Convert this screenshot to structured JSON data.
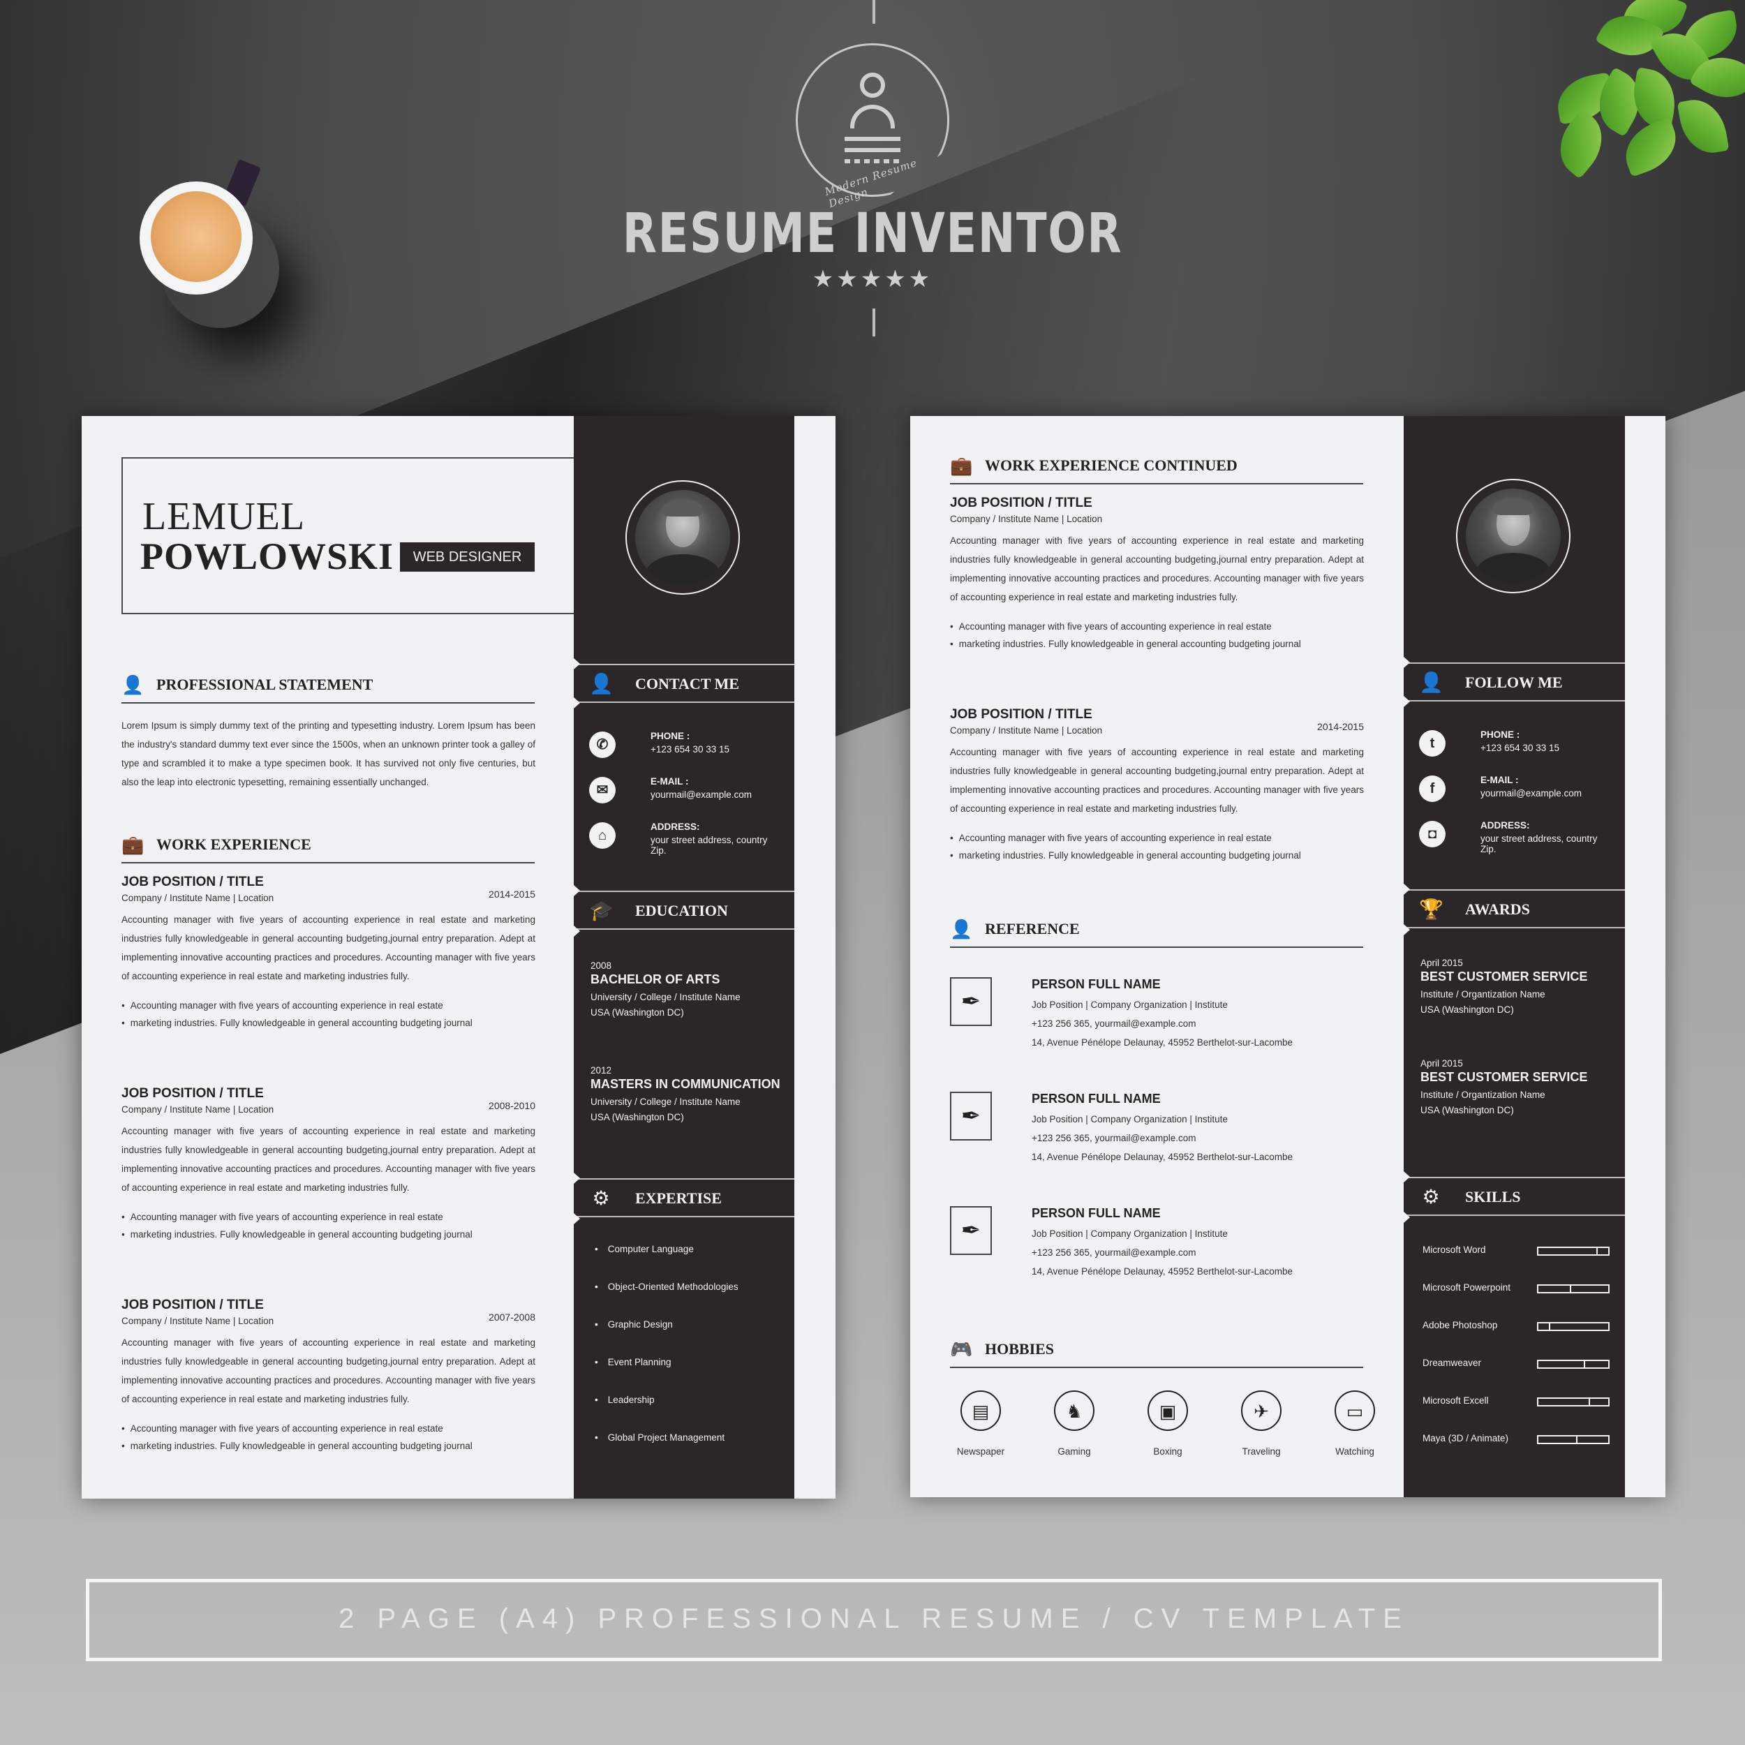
{
  "branding": {
    "logo_tagline": "Modern Resume Design",
    "title": "RESUME INVENTOR",
    "rating_stars": 5,
    "stars": "★★★★★"
  },
  "footer": {
    "banner": "2 PAGE (A4) PROFESSIONAL RESUME / CV TEMPLATE"
  },
  "page1": {
    "first_name": "LEMUEL",
    "last_name": "POWLOWSKI",
    "role": "WEB DESIGNER",
    "statement": {
      "title": "PROFESSIONAL STATEMENT",
      "icon": "user-tie-icon",
      "text": "Lorem Ipsum is simply dummy text of the printing and typesetting industry. Lorem Ipsum has been the industry's standard dummy text ever since the 1500s, when an unknown printer took a galley of type and scrambled it to make a type specimen book. It has survived not only five centuries, but also the leap into electronic typesetting, remaining essentially unchanged."
    },
    "work": {
      "title": "WORK EXPERIENCE",
      "icon": "briefcase-icon",
      "jobs": [
        {
          "title": "JOB POSITION / TITLE",
          "company": "Company / Institute Name  |  Location",
          "dates": "2014-2015",
          "desc": "Accounting manager with five years of accounting experience in real estate and marketing industries fully knowledgeable in general accounting budgeting,journal entry preparation. Adept at implementing innovative accounting practices and procedures. Accounting manager with five years of accounting experience in real estate and marketing industries fully.",
          "bullets": [
            "Accounting manager with five years of accounting experience in real estate",
            "marketing industries. Fully knowledgeable in general accounting budgeting journal"
          ]
        },
        {
          "title": "JOB POSITION / TITLE",
          "company": "Company / Institute Name  |  Location",
          "dates": "2008-2010",
          "desc": "Accounting manager with five years of accounting experience in real estate and marketing industries fully knowledgeable in general accounting budgeting,journal entry preparation. Adept at implementing innovative accounting practices and procedures. Accounting manager with five years of accounting experience in real estate and marketing industries fully.",
          "bullets": [
            "Accounting manager with five years of accounting experience in real estate",
            "marketing industries. Fully knowledgeable in general accounting budgeting journal"
          ]
        },
        {
          "title": "JOB POSITION / TITLE",
          "company": "Company / Institute Name  |  Location",
          "dates": "2007-2008",
          "desc": "Accounting manager with five years of accounting experience in real estate and marketing industries fully knowledgeable in general accounting budgeting,journal entry preparation. Adept at implementing innovative accounting practices and procedures. Accounting manager with five years of accounting experience in real estate and marketing industries fully.",
          "bullets": [
            "Accounting manager with five years of accounting experience in real estate",
            "marketing industries. Fully knowledgeable in general accounting budgeting journal"
          ]
        }
      ]
    },
    "contact": {
      "title": "CONTACT ME",
      "items": [
        {
          "icon": "phone-icon",
          "glyph": "✆",
          "label": "PHONE :",
          "value": "+123 654 30 33 15"
        },
        {
          "icon": "envelope-icon",
          "glyph": "✉",
          "label": "E-MAIL :",
          "value": "yourmail@example.com"
        },
        {
          "icon": "home-icon",
          "glyph": "⌂",
          "label": "ADDRESS:",
          "value": "your street address, country Zip."
        }
      ]
    },
    "education": {
      "title": "EDUCATION",
      "items": [
        {
          "year": "2008",
          "degree": "BACHELOR OF ARTS",
          "school": "University / College / Institute Name",
          "place": "USA (Washington DC)"
        },
        {
          "year": "2012",
          "degree": "MASTERS IN COMMUNICATION",
          "school": "University / College / Institute Name",
          "place": "USA (Washington DC)"
        }
      ]
    },
    "expertise": {
      "title": "EXPERTISE",
      "items": [
        "Computer Language",
        "Object-Oriented Methodologies",
        "Graphic Design",
        "Event Planning",
        "Leadership",
        "Global Project Management"
      ]
    }
  },
  "page2": {
    "work": {
      "title": "WORK EXPERIENCE CONTINUED",
      "jobs": [
        {
          "title": "JOB POSITION / TITLE",
          "company": "Company / Institute Name  |  Location",
          "dates": "",
          "desc": "Accounting manager with five years of accounting experience in real estate and marketing industries fully knowledgeable in general accounting budgeting,journal entry preparation. Adept at implementing innovative accounting practices and procedures. Accounting manager with five years of accounting experience in real estate and marketing industries fully.",
          "bullets": [
            "Accounting manager with five years of accounting experience in real estate",
            "marketing industries. Fully knowledgeable in general accounting budgeting journal"
          ]
        },
        {
          "title": "JOB POSITION / TITLE",
          "company": "Company / Institute Name  |  Location",
          "dates": "2014-2015",
          "desc": "Accounting manager with five years of accounting experience in real estate and marketing industries fully knowledgeable in general accounting budgeting,journal entry preparation. Adept at implementing innovative accounting practices and procedures. Accounting manager with five years of accounting experience in real estate and marketing industries fully.",
          "bullets": [
            "Accounting manager with five years of accounting experience in real estate",
            "marketing industries. Fully knowledgeable in general accounting budgeting journal"
          ]
        }
      ]
    },
    "reference": {
      "title": "REFERENCE",
      "items": [
        {
          "name": "PERSON FULL NAME",
          "position": "Job Position    |    Company Organization | Institute",
          "contact": "+123 256 365, yourmail@example.com",
          "address": "14, Avenue Pénélope Delaunay, 45952 Berthelot-sur-Lacombe"
        },
        {
          "name": "PERSON FULL NAME",
          "position": "Job Position    |    Company Organization | Institute",
          "contact": "+123 256 365, yourmail@example.com",
          "address": "14, Avenue Pénélope Delaunay, 45952 Berthelot-sur-Lacombe"
        },
        {
          "name": "PERSON FULL NAME",
          "position": "Job Position    |    Company Organization | Institute",
          "contact": "+123 256 365, yourmail@example.com",
          "address": "14, Avenue Pénélope Delaunay, 45952 Berthelot-sur-Lacombe"
        }
      ]
    },
    "hobbies": {
      "title": "HOBBIES",
      "items": [
        {
          "label": "Newspaper",
          "icon": "newspaper-icon",
          "glyph": "▤"
        },
        {
          "label": "Gaming",
          "icon": "chess-knight-icon",
          "glyph": "♞"
        },
        {
          "label": "Boxing",
          "icon": "boxing-glove-icon",
          "glyph": "▣"
        },
        {
          "label": "Traveling",
          "icon": "airplane-icon",
          "glyph": "✈"
        },
        {
          "label": "Watching",
          "icon": "tv-icon",
          "glyph": "▭"
        }
      ]
    },
    "follow": {
      "title": "FOLLOW ME",
      "items": [
        {
          "icon": "twitter-icon",
          "glyph": "t",
          "label": "PHONE :",
          "value": "+123 654 30 33 15"
        },
        {
          "icon": "facebook-icon",
          "glyph": "f",
          "label": "E-MAIL :",
          "value": "yourmail@example.com"
        },
        {
          "icon": "instagram-icon",
          "glyph": "◘",
          "label": "ADDRESS:",
          "value": "your street address, country Zip."
        }
      ]
    },
    "awards": {
      "title": "AWARDS",
      "items": [
        {
          "date": "April 2015",
          "title": "BEST CUSTOMER SERVICE",
          "org": "Institute / Organtization Name",
          "place": "USA (Washington DC)"
        },
        {
          "date": "April 2015",
          "title": "BEST CUSTOMER SERVICE",
          "org": "Institute / Organtization Name",
          "place": "USA (Washington DC)"
        }
      ]
    },
    "skills": {
      "title": "SKILLS",
      "items": [
        {
          "name": "Microsoft Word",
          "level": 0.83
        },
        {
          "name": "Microsoft Powerpoint",
          "level": 0.45
        },
        {
          "name": "Adobe Photoshop",
          "level": 0.15
        },
        {
          "name": "Dreamweaver",
          "level": 0.65
        },
        {
          "name": "Microsoft Excell",
          "level": 0.72
        },
        {
          "name": "Maya (3D / Animate)",
          "level": 0.54
        }
      ]
    }
  }
}
